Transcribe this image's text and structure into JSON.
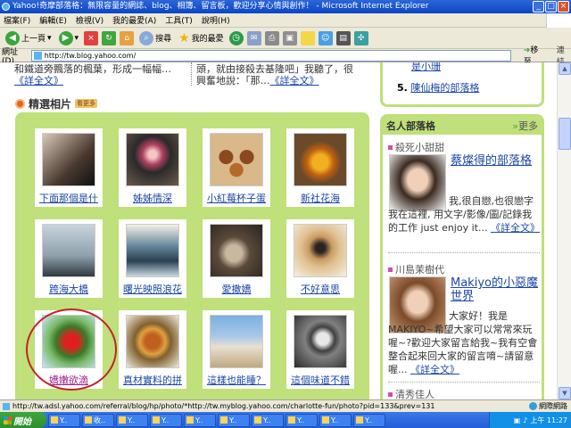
{
  "window": {
    "title": "Yahoo!奇摩部落格：無限容量的網誌、blog、相簿、留言板，歡迎分享心情與創作！ - Microsoft Internet Explorer"
  },
  "menu": [
    "檔案(F)",
    "編輯(E)",
    "檢視(V)",
    "我的最愛(A)",
    "工具(T)",
    "說明(H)"
  ],
  "toolbar": {
    "back": "上一頁",
    "search": "搜尋",
    "favorites": "我的最愛"
  },
  "address": {
    "label": "網址(D)",
    "url": "http://tw.blog.yahoo.com/",
    "go": "移至",
    "links": "連結"
  },
  "top": {
    "left_line1": "和鐵道旁飄落的楓葉，形成一幅幅…",
    "left_more": "《詳全文》",
    "mid_line1": "頭，就由接殺去基隆吧」我聽了，很",
    "mid_line2a": "興奮地說：「那…",
    "mid_more": "《詳全文》",
    "right_item4": "是小珊",
    "right_num5": "5.",
    "right_item5": "陳仙梅的部落格"
  },
  "photos": {
    "heading": "精選相片",
    "more_badge": "看更多",
    "items": [
      {
        "caption": "下面那個是什"
      },
      {
        "caption": "姊姊情深"
      },
      {
        "caption": "小紅莓杯子蛋"
      },
      {
        "caption": "新社花海"
      },
      {
        "caption": "跨海大橋"
      },
      {
        "caption": "曙光映照浪花"
      },
      {
        "caption": "愛撒嬌"
      },
      {
        "caption": "不好意思"
      },
      {
        "caption": "嬌嫩欲滴"
      },
      {
        "caption": "真材實料的拼"
      },
      {
        "caption": "這樣也能睡？"
      },
      {
        "caption": "這個味道不錯"
      }
    ]
  },
  "famous": {
    "heading": "名人部落格",
    "more": "更多",
    "entries": [
      {
        "category": "殺死小甜甜",
        "title": "蔡燦得的部落格",
        "desc": "我,很自戀,也很戀字我在這裡, 用文字/影像/圖/記錄我的工作 just enjoy it...",
        "more": "《詳全文》"
      },
      {
        "category": "川島茉樹代",
        "title": "Makiyo的小惡魔世界",
        "desc": "大家好！我是MAKIYO~希望大家可以常常來玩喔~?歡迎大家留言給我~我有空會整合起來回大家的留言唷~請留意喔...",
        "more": "《詳全文》"
      },
      {
        "category": "清秀佳人"
      }
    ]
  },
  "status": {
    "url": "http://tw.adsl.yahoo.com/referral/blog/hp/photo/*http://tw.myblog.yahoo.com/charlotte-fun/photo?pid=133&prev=131",
    "zone": "網際網路"
  },
  "taskbar": {
    "start": "開始",
    "tasks": [
      "Y..",
      "收..",
      "Y..",
      "Y..",
      "Y..",
      "Y..",
      "Y..",
      "Y..",
      "Y..",
      "Y.."
    ],
    "clock": "上午 11:27"
  },
  "colors": {
    "accent_green": "#bfe07a",
    "link_blue": "#1b48a6",
    "highlight_red": "#c4222a"
  }
}
